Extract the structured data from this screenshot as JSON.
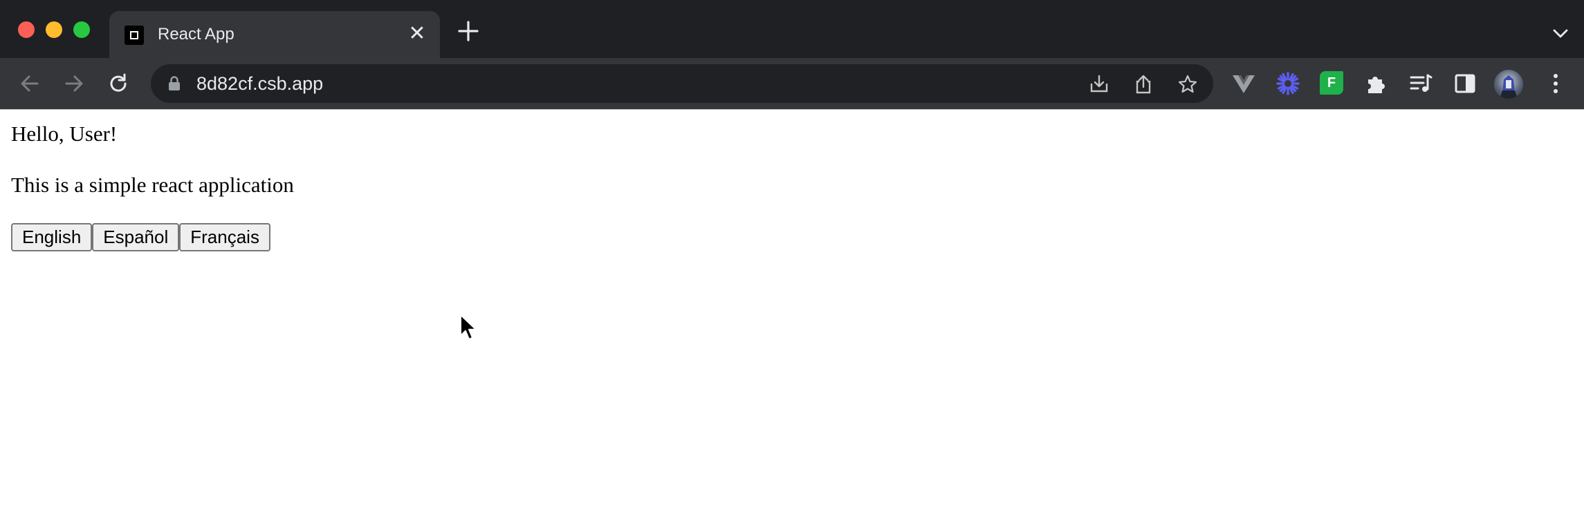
{
  "browser": {
    "tab": {
      "title": "React App",
      "close_glyph": "✕"
    },
    "address": {
      "url": "8d82cf.csb.app"
    },
    "icons": {
      "back": "arrow-left-icon",
      "forward": "arrow-right-icon",
      "reload": "reload-icon",
      "lock": "lock-icon",
      "install": "install-app-icon",
      "share": "share-icon",
      "bookmark": "star-icon",
      "extension_v": "vue-devtools-icon",
      "extension_blue": "blue-asterisk-extension-icon",
      "extension_f": "green-f-extension-icon",
      "extensions": "puzzle-icon",
      "reading_list": "media-queue-icon",
      "side_panel": "side-panel-icon",
      "profile": "profile-avatar",
      "menu": "three-dots-menu-icon",
      "tab_search": "chevron-down-icon",
      "new_tab": "plus-icon"
    },
    "colors": {
      "titlebar": "#1f2023",
      "toolbar": "#35363a",
      "omnibox": "#202124",
      "close_red": "#fe5f57",
      "minimize_yellow": "#febc2e",
      "zoom_green": "#28c840"
    },
    "extension_f_label": "F"
  },
  "page": {
    "greeting": "Hello, User!",
    "description": "This is a simple react application",
    "language_buttons": [
      {
        "label": "English"
      },
      {
        "label": "Español"
      },
      {
        "label": "Français"
      }
    ]
  }
}
